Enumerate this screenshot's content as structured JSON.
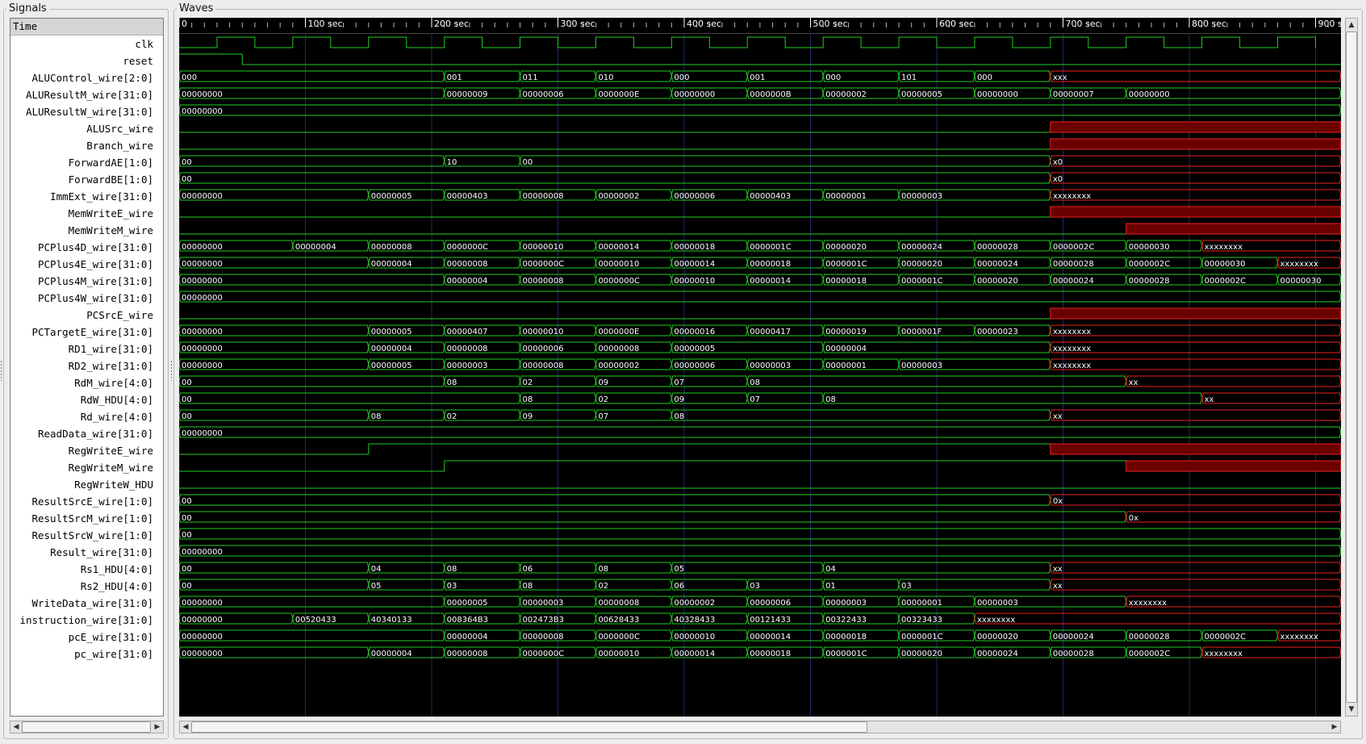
{
  "panels": {
    "signals_title": "Signals",
    "waves_title": "Waves"
  },
  "time_header": "Time",
  "timeline": {
    "tick_labels": [
      "0",
      "100 sec",
      "200 sec",
      "300 sec",
      "400 sec",
      "500 sec",
      "600 sec",
      "700 sec",
      "800 sec",
      "900 sec"
    ],
    "tick_values": [
      0,
      100,
      200,
      300,
      400,
      500,
      600,
      700,
      800,
      900
    ],
    "period": 60,
    "end": 920
  },
  "colors": {
    "wave": "#22cc22",
    "undef_fill": "#6a0000",
    "undef_line": "#ee2222",
    "grid": "#1f2a66",
    "text": "#ffffff"
  },
  "signals": [
    {
      "name": "clk",
      "type": "clock"
    },
    {
      "name": "reset",
      "type": "bit",
      "t": [
        0,
        50
      ],
      "v": [
        1,
        0
      ]
    },
    {
      "name": "ALUControl_wire[2:0]",
      "type": "bus",
      "t": [
        0,
        210,
        270,
        330,
        390,
        450,
        510,
        570,
        630,
        690
      ],
      "v": [
        "000",
        "001",
        "011",
        "010",
        "000",
        "001",
        "000",
        "101",
        "000",
        "xxx"
      ]
    },
    {
      "name": "ALUResultM_wire[31:0]",
      "type": "bus",
      "t": [
        0,
        210,
        270,
        330,
        390,
        450,
        510,
        570,
        630,
        690,
        750
      ],
      "v": [
        "00000000",
        "00000009",
        "00000006",
        "0000000E",
        "00000000",
        "0000000B",
        "00000002",
        "00000005",
        "00000000",
        "00000007",
        "00000000"
      ]
    },
    {
      "name": "ALUResultW_wire[31:0]",
      "type": "bus",
      "t": [
        0
      ],
      "v": [
        "00000000"
      ]
    },
    {
      "name": "ALUSrc_wire",
      "type": "bit",
      "t": [
        0,
        690
      ],
      "v": [
        0,
        "x"
      ]
    },
    {
      "name": "Branch_wire",
      "type": "bit",
      "t": [
        0,
        690
      ],
      "v": [
        0,
        "x"
      ]
    },
    {
      "name": "ForwardAE[1:0]",
      "type": "bus",
      "t": [
        0,
        210,
        270,
        690
      ],
      "v": [
        "00",
        "10",
        "00",
        "x0"
      ]
    },
    {
      "name": "ForwardBE[1:0]",
      "type": "bus",
      "t": [
        0,
        690
      ],
      "v": [
        "00",
        "x0"
      ]
    },
    {
      "name": "ImmExt_wire[31:0]",
      "type": "bus",
      "t": [
        0,
        150,
        210,
        270,
        330,
        390,
        450,
        510,
        570,
        690
      ],
      "v": [
        "00000000",
        "00000005",
        "00000403",
        "00000008",
        "00000002",
        "00000006",
        "00000403",
        "00000001",
        "00000003",
        "xxxxxxxx"
      ]
    },
    {
      "name": "MemWriteE_wire",
      "type": "bit",
      "t": [
        0,
        690
      ],
      "v": [
        0,
        "x"
      ]
    },
    {
      "name": "MemWriteM_wire",
      "type": "bit",
      "t": [
        0,
        750
      ],
      "v": [
        0,
        "x"
      ]
    },
    {
      "name": "PCPlus4D_wire[31:0]",
      "type": "bus",
      "t": [
        0,
        90,
        150,
        210,
        270,
        330,
        390,
        450,
        510,
        570,
        630,
        690,
        750,
        810
      ],
      "v": [
        "00000000",
        "00000004",
        "00000008",
        "0000000C",
        "00000010",
        "00000014",
        "00000018",
        "0000001C",
        "00000020",
        "00000024",
        "00000028",
        "0000002C",
        "00000030",
        "xxxxxxxx"
      ]
    },
    {
      "name": "PCPlus4E_wire[31:0]",
      "type": "bus",
      "t": [
        0,
        150,
        210,
        270,
        330,
        390,
        450,
        510,
        570,
        630,
        690,
        750,
        810,
        870
      ],
      "v": [
        "00000000",
        "00000004",
        "00000008",
        "0000000C",
        "00000010",
        "00000014",
        "00000018",
        "0000001C",
        "00000020",
        "00000024",
        "00000028",
        "0000002C",
        "00000030",
        "xxxxxxxx"
      ]
    },
    {
      "name": "PCPlus4M_wire[31:0]",
      "type": "bus",
      "t": [
        0,
        210,
        270,
        330,
        390,
        450,
        510,
        570,
        630,
        690,
        750,
        810,
        870
      ],
      "v": [
        "00000000",
        "00000004",
        "00000008",
        "0000000C",
        "00000010",
        "00000014",
        "00000018",
        "0000001C",
        "00000020",
        "00000024",
        "00000028",
        "0000002C",
        "00000030"
      ]
    },
    {
      "name": "PCPlus4W_wire[31:0]",
      "type": "bus",
      "t": [
        0
      ],
      "v": [
        "00000000"
      ]
    },
    {
      "name": "PCSrcE_wire",
      "type": "bit",
      "t": [
        0,
        690
      ],
      "v": [
        0,
        "x"
      ]
    },
    {
      "name": "PCTargetE_wire[31:0]",
      "type": "bus",
      "t": [
        0,
        150,
        210,
        270,
        330,
        390,
        450,
        510,
        570,
        630,
        690
      ],
      "v": [
        "00000000",
        "00000005",
        "00000407",
        "00000010",
        "0000000E",
        "00000016",
        "00000417",
        "00000019",
        "0000001F",
        "00000023",
        "xxxxxxxx"
      ]
    },
    {
      "name": "RD1_wire[31:0]",
      "type": "bus",
      "t": [
        0,
        150,
        210,
        270,
        330,
        390,
        510,
        690
      ],
      "v": [
        "00000000",
        "00000004",
        "00000008",
        "00000006",
        "00000008",
        "00000005",
        "00000004",
        "xxxxxxxx"
      ]
    },
    {
      "name": "RD2_wire[31:0]",
      "type": "bus",
      "t": [
        0,
        150,
        210,
        270,
        330,
        390,
        450,
        510,
        570,
        690
      ],
      "v": [
        "00000000",
        "00000005",
        "00000003",
        "00000008",
        "00000002",
        "00000006",
        "00000003",
        "00000001",
        "00000003",
        "xxxxxxxx"
      ]
    },
    {
      "name": "RdM_wire[4:0]",
      "type": "bus",
      "t": [
        0,
        210,
        270,
        330,
        390,
        450,
        750
      ],
      "v": [
        "00",
        "08",
        "02",
        "09",
        "07",
        "08",
        "xx"
      ]
    },
    {
      "name": "RdW_HDU[4:0]",
      "type": "bus",
      "t": [
        0,
        270,
        330,
        390,
        450,
        510,
        810
      ],
      "v": [
        "00",
        "08",
        "02",
        "09",
        "07",
        "08",
        "xx"
      ]
    },
    {
      "name": "Rd_wire[4:0]",
      "type": "bus",
      "t": [
        0,
        150,
        210,
        270,
        330,
        390,
        690
      ],
      "v": [
        "00",
        "08",
        "02",
        "09",
        "07",
        "08",
        "xx"
      ]
    },
    {
      "name": "ReadData_wire[31:0]",
      "type": "bus",
      "t": [
        0
      ],
      "v": [
        "00000000"
      ]
    },
    {
      "name": "RegWriteE_wire",
      "type": "bit",
      "t": [
        0,
        150,
        690
      ],
      "v": [
        0,
        1,
        "x"
      ]
    },
    {
      "name": "RegWriteM_wire",
      "type": "bit",
      "t": [
        0,
        210,
        750
      ],
      "v": [
        0,
        1,
        "x"
      ]
    },
    {
      "name": "RegWriteW_HDU",
      "type": "bit",
      "t": [
        0
      ],
      "v": [
        0
      ]
    },
    {
      "name": "ResultSrcE_wire[1:0]",
      "type": "bus",
      "t": [
        0,
        690
      ],
      "v": [
        "00",
        "0x"
      ]
    },
    {
      "name": "ResultSrcM_wire[1:0]",
      "type": "bus",
      "t": [
        0,
        750
      ],
      "v": [
        "00",
        "0x"
      ]
    },
    {
      "name": "ResultSrcW_wire[1:0]",
      "type": "bus",
      "t": [
        0
      ],
      "v": [
        "00"
      ]
    },
    {
      "name": "Result_wire[31:0]",
      "type": "bus",
      "t": [
        0
      ],
      "v": [
        "00000000"
      ]
    },
    {
      "name": "Rs1_HDU[4:0]",
      "type": "bus",
      "t": [
        0,
        150,
        210,
        270,
        330,
        390,
        510,
        690
      ],
      "v": [
        "00",
        "04",
        "08",
        "06",
        "08",
        "05",
        "04",
        "xx"
      ]
    },
    {
      "name": "Rs2_HDU[4:0]",
      "type": "bus",
      "t": [
        0,
        150,
        210,
        270,
        330,
        390,
        450,
        510,
        570,
        690
      ],
      "v": [
        "00",
        "05",
        "03",
        "08",
        "02",
        "06",
        "03",
        "01",
        "03",
        "xx"
      ]
    },
    {
      "name": "WriteData_wire[31:0]",
      "type": "bus",
      "t": [
        0,
        210,
        270,
        330,
        390,
        450,
        510,
        570,
        630,
        750
      ],
      "v": [
        "00000000",
        "00000005",
        "00000003",
        "00000008",
        "00000002",
        "00000006",
        "00000003",
        "00000001",
        "00000003",
        "xxxxxxxx"
      ]
    },
    {
      "name": "instruction_wire[31:0]",
      "type": "bus",
      "t": [
        0,
        90,
        150,
        210,
        270,
        330,
        390,
        450,
        510,
        570,
        630
      ],
      "v": [
        "00000000",
        "00520433",
        "40340133",
        "008364B3",
        "002473B3",
        "00628433",
        "40328433",
        "00121433",
        "00322433",
        "00323433",
        "xxxxxxxx"
      ]
    },
    {
      "name": "pcE_wire[31:0]",
      "type": "bus",
      "t": [
        0,
        210,
        270,
        330,
        390,
        450,
        510,
        570,
        630,
        690,
        750,
        810,
        870
      ],
      "v": [
        "00000000",
        "00000004",
        "00000008",
        "0000000C",
        "00000010",
        "00000014",
        "00000018",
        "0000001C",
        "00000020",
        "00000024",
        "00000028",
        "0000002C",
        "xxxxxxxx"
      ]
    },
    {
      "name": "pc_wire[31:0]",
      "type": "bus",
      "t": [
        0,
        150,
        210,
        270,
        330,
        390,
        450,
        510,
        570,
        630,
        690,
        750,
        810
      ],
      "v": [
        "00000000",
        "00000004",
        "00000008",
        "0000000C",
        "00000010",
        "00000014",
        "00000018",
        "0000001C",
        "00000020",
        "00000024",
        "00000028",
        "0000002C",
        "xxxxxxxx"
      ]
    }
  ]
}
